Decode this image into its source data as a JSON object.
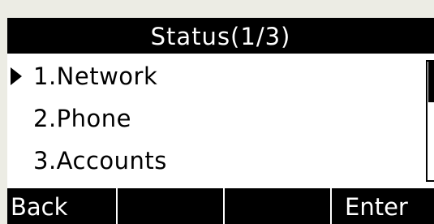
{
  "status": {
    "title": "Status(1/3)"
  },
  "menu": {
    "items": [
      {
        "label": "1.Network",
        "selected": true
      },
      {
        "label": "2.Phone",
        "selected": false
      },
      {
        "label": "3.Accounts",
        "selected": false
      }
    ]
  },
  "softkeys": {
    "back": "Back",
    "key2": "",
    "key3": "",
    "enter": "Enter"
  },
  "colors": {
    "screen_bg": "#ffffff",
    "bar_bg": "#000000",
    "bar_text": "#ffffff",
    "bezel": "#ececE4"
  },
  "icons": {
    "selection_cursor": "triangle-right"
  }
}
